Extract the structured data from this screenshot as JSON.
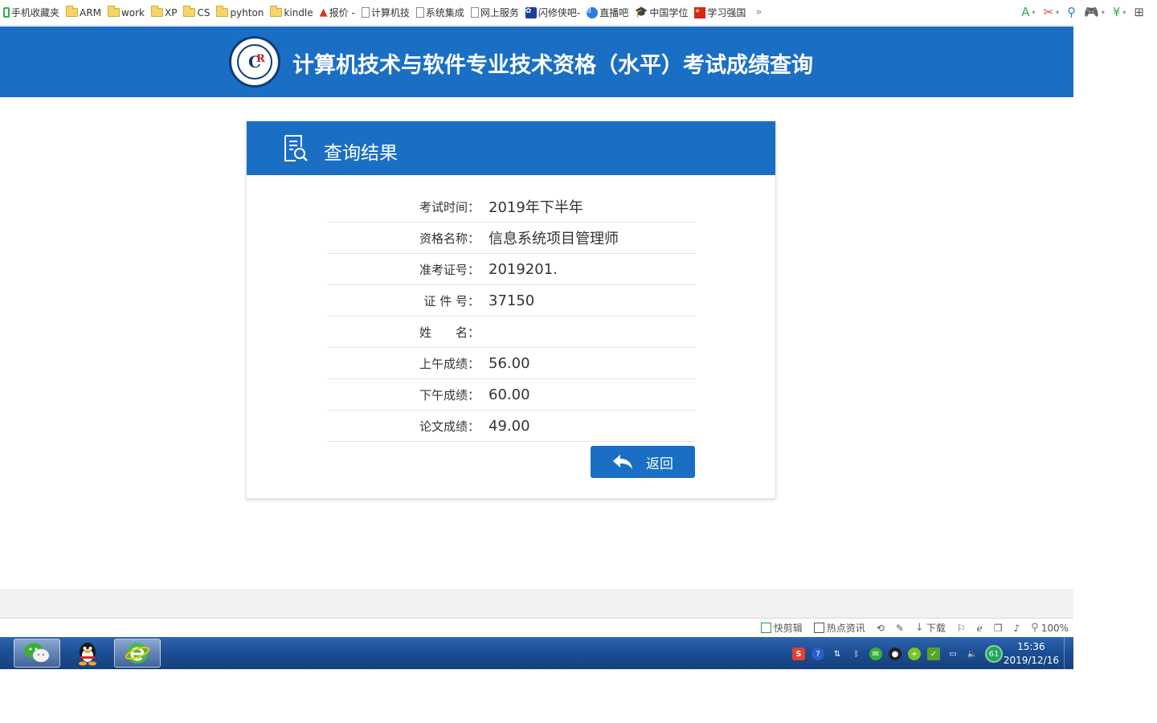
{
  "bookmarks": [
    {
      "label": "手机收藏夹",
      "icon": "phone-icon"
    },
    {
      "label": "ARM",
      "icon": "folder-icon"
    },
    {
      "label": "work",
      "icon": "folder-icon"
    },
    {
      "label": "XP",
      "icon": "folder-icon"
    },
    {
      "label": "CS",
      "icon": "folder-icon"
    },
    {
      "label": "pyhton",
      "icon": "folder-icon"
    },
    {
      "label": "kindle",
      "icon": "folder-icon"
    },
    {
      "label": "报价 -",
      "icon": "triangle-logo-icon"
    },
    {
      "label": "计算机技",
      "icon": "page-icon"
    },
    {
      "label": "系统集成",
      "icon": "page-icon"
    },
    {
      "label": "网上服务",
      "icon": "page-icon"
    },
    {
      "label": "闪修侠吧-",
      "icon": "paw-icon"
    },
    {
      "label": "直播吧",
      "icon": "blue-circle-icon"
    },
    {
      "label": "中国学位",
      "icon": "graduation-cap-icon"
    },
    {
      "label": "学习强国",
      "icon": "red-square-icon"
    }
  ],
  "bookmarks_more": "»",
  "header": {
    "title": "计算机技术与软件专业技术资格（水平）考试成绩查询",
    "logo_letter": "C",
    "logo_mark": "R"
  },
  "card": {
    "title": "查询结果",
    "rows": [
      {
        "label": "考试时间：",
        "value": "2019年下半年"
      },
      {
        "label": "资格名称：",
        "value": "信息系统项目管理师"
      },
      {
        "label": "准考证号：",
        "value": "2019201."
      },
      {
        "label": "证 件 号：",
        "value": "37150"
      },
      {
        "label": "姓　　名：",
        "value": ""
      },
      {
        "label": "上午成绩：",
        "value": "56.00"
      },
      {
        "label": "下午成绩：",
        "value": "60.00"
      },
      {
        "label": "论文成绩：",
        "value": "49.00"
      }
    ],
    "back_label": "返回"
  },
  "statusbar": {
    "quick_clip": "快剪辑",
    "hot_news": "热点资讯",
    "download": "下载",
    "zoom": "100%"
  },
  "taskbar": {
    "time": "15:36",
    "date": "2019/12/16",
    "battery_badge": "61"
  },
  "colors": {
    "primary": "#1a6fc4",
    "text": "#333333"
  }
}
